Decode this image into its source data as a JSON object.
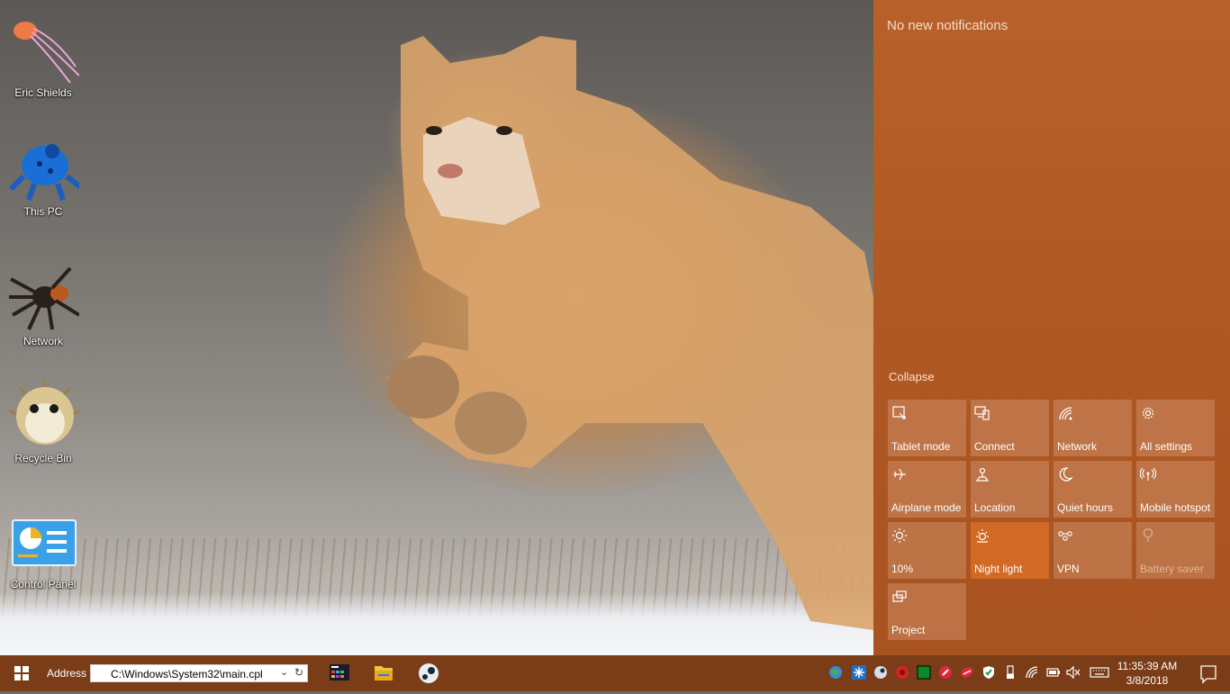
{
  "desktop": {
    "icons": [
      {
        "label": "Eric Shields",
        "icon": "jellyfish-icon"
      },
      {
        "label": "This PC",
        "icon": "frog-icon"
      },
      {
        "label": "Network",
        "icon": "spider-icon"
      },
      {
        "label": "Recycle Bin",
        "icon": "pufferfish-icon"
      },
      {
        "label": "Control Panel",
        "icon": "control-panel-icon"
      }
    ]
  },
  "action_center": {
    "title": "No new notifications",
    "collapse_label": "Collapse",
    "accent_color": "#d26a26",
    "tiles": [
      {
        "label": "Tablet mode",
        "icon": "tablet-mode-icon",
        "state": "off"
      },
      {
        "label": "Connect",
        "icon": "connect-icon",
        "state": "off"
      },
      {
        "label": "Network",
        "icon": "network-icon",
        "state": "off"
      },
      {
        "label": "All settings",
        "icon": "gear-icon",
        "state": "off"
      },
      {
        "label": "Airplane mode",
        "icon": "airplane-icon",
        "state": "off"
      },
      {
        "label": "Location",
        "icon": "location-icon",
        "state": "off"
      },
      {
        "label": "Quiet hours",
        "icon": "moon-icon",
        "state": "off"
      },
      {
        "label": "Mobile hotspot",
        "icon": "hotspot-icon",
        "state": "off"
      },
      {
        "label": "10%",
        "icon": "brightness-icon",
        "state": "off"
      },
      {
        "label": "Night light",
        "icon": "night-light-icon",
        "state": "on"
      },
      {
        "label": "VPN",
        "icon": "vpn-icon",
        "state": "off"
      },
      {
        "label": "Battery saver",
        "icon": "battery-saver-icon",
        "state": "disabled"
      },
      {
        "label": "Project",
        "icon": "project-icon",
        "state": "off"
      }
    ]
  },
  "taskbar": {
    "start_icon": "windows-logo-icon",
    "address_label": "Address",
    "address_value": "C:\\Windows\\System32\\main.cpl",
    "pinned": [
      {
        "name": "start-app",
        "icon": "start-menu-app-icon"
      },
      {
        "name": "file-explorer",
        "icon": "folder-icon"
      },
      {
        "name": "steam",
        "icon": "steam-icon"
      }
    ],
    "tray": [
      "globe-icon",
      "snowflake-icon",
      "steam-tray-icon",
      "red-circle-icon",
      "green-square-icon",
      "red-app-icon",
      "red-app-2-icon",
      "shield-icon",
      "usb-icon",
      "wifi-icon",
      "battery-icon",
      "mute-icon",
      "keyboard-icon"
    ],
    "time": "11:35:39 AM",
    "date": "3/8/2018",
    "notification_icon": "notification-icon"
  }
}
